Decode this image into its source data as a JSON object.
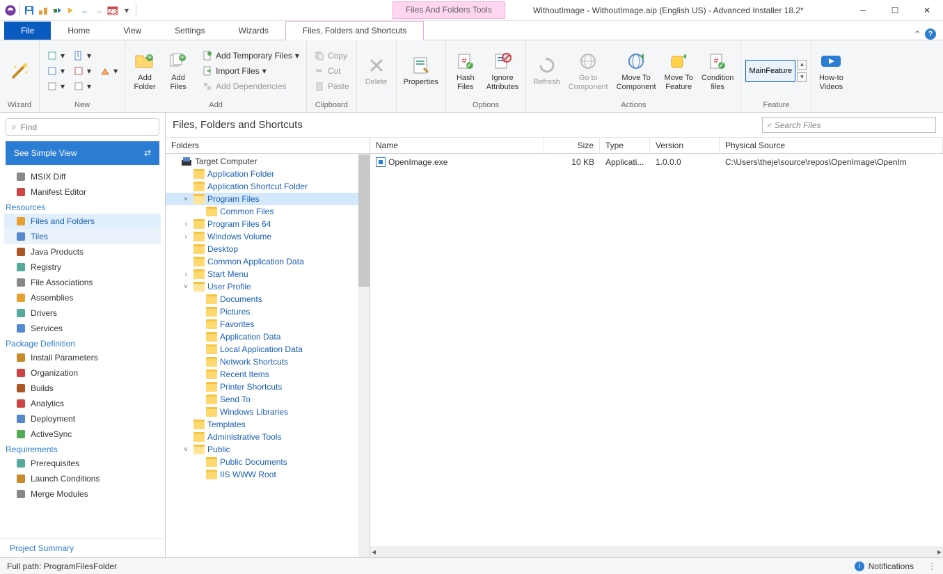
{
  "titlebar": {
    "context_label": "Files And Folders Tools",
    "title": "WithoutImage - WithoutImage.aip (English US) - Advanced Installer 18.2*"
  },
  "tabs": {
    "file": "File",
    "home": "Home",
    "view": "View",
    "settings": "Settings",
    "wizards": "Wizards",
    "context": "Files, Folders and Shortcuts"
  },
  "ribbon": {
    "wizard": {
      "label": "Wizard"
    },
    "new": {
      "label": "New"
    },
    "add": {
      "label": "Add",
      "add_folder": "Add\nFolder",
      "add_files": "Add\nFiles",
      "add_temp": "Add Temporary Files",
      "import_files": "Import Files",
      "add_deps": "Add Dependencies"
    },
    "clipboard": {
      "label": "Clipboard",
      "copy": "Copy",
      "cut": "Cut",
      "paste": "Paste"
    },
    "delete": "Delete",
    "properties": "Properties",
    "options": {
      "label": "Options",
      "hash": "Hash\nFiles",
      "ignore": "Ignore\nAttributes"
    },
    "actions": {
      "label": "Actions",
      "refresh": "Refresh",
      "goto": "Go to\nComponent",
      "move_comp": "Move To\nComponent",
      "move_feat": "Move To\nFeature",
      "cond": "Condition\nfiles"
    },
    "feature": {
      "label": "Feature",
      "value": "MainFeature"
    },
    "howto": "How-to\nVideos"
  },
  "left": {
    "find_placeholder": "Find",
    "simple_view": "See Simple View",
    "items_top": [
      {
        "label": "MSIX Diff"
      },
      {
        "label": "Manifest Editor"
      }
    ],
    "section_resources": "Resources",
    "resources": [
      {
        "label": "Files and Folders",
        "primary": true
      },
      {
        "label": "Tiles",
        "secondary": true
      },
      {
        "label": "Java Products"
      },
      {
        "label": "Registry"
      },
      {
        "label": "File Associations"
      },
      {
        "label": "Assemblies"
      },
      {
        "label": "Drivers"
      },
      {
        "label": "Services"
      }
    ],
    "section_pkg": "Package Definition",
    "pkg": [
      {
        "label": "Install Parameters"
      },
      {
        "label": "Organization"
      },
      {
        "label": "Builds"
      },
      {
        "label": "Analytics"
      },
      {
        "label": "Deployment"
      },
      {
        "label": "ActiveSync"
      }
    ],
    "section_req": "Requirements",
    "req": [
      {
        "label": "Prerequisites"
      },
      {
        "label": "Launch Conditions"
      },
      {
        "label": "Merge Modules"
      }
    ],
    "footer": "Project Summary"
  },
  "center": {
    "title": "Files, Folders and Shortcuts",
    "search_placeholder": "Search Files",
    "folders_label": "Folders",
    "tree": [
      {
        "label": "Target Computer",
        "indent": 0,
        "root": true,
        "exp": ""
      },
      {
        "label": "Application Folder",
        "indent": 1,
        "exp": ""
      },
      {
        "label": "Application Shortcut Folder",
        "indent": 1,
        "exp": ""
      },
      {
        "label": "Program Files",
        "indent": 1,
        "exp": "˅",
        "sel": true,
        "open": true
      },
      {
        "label": "Common Files",
        "indent": 2,
        "exp": ""
      },
      {
        "label": "Program Files 64",
        "indent": 1,
        "exp": "›"
      },
      {
        "label": "Windows Volume",
        "indent": 1,
        "exp": "›"
      },
      {
        "label": "Desktop",
        "indent": 1,
        "exp": ""
      },
      {
        "label": "Common Application Data",
        "indent": 1,
        "exp": ""
      },
      {
        "label": "Start Menu",
        "indent": 1,
        "exp": "›"
      },
      {
        "label": "User Profile",
        "indent": 1,
        "exp": "˅",
        "open": true
      },
      {
        "label": "Documents",
        "indent": 2,
        "exp": ""
      },
      {
        "label": "Pictures",
        "indent": 2,
        "exp": ""
      },
      {
        "label": "Favorites",
        "indent": 2,
        "exp": ""
      },
      {
        "label": "Application Data",
        "indent": 2,
        "exp": ""
      },
      {
        "label": "Local Application Data",
        "indent": 2,
        "exp": ""
      },
      {
        "label": "Network Shortcuts",
        "indent": 2,
        "exp": ""
      },
      {
        "label": "Recent Items",
        "indent": 2,
        "exp": ""
      },
      {
        "label": "Printer Shortcuts",
        "indent": 2,
        "exp": ""
      },
      {
        "label": "Send To",
        "indent": 2,
        "exp": ""
      },
      {
        "label": "Windows Libraries",
        "indent": 2,
        "exp": ""
      },
      {
        "label": "Templates",
        "indent": 1,
        "exp": ""
      },
      {
        "label": "Administrative Tools",
        "indent": 1,
        "exp": ""
      },
      {
        "label": "Public",
        "indent": 1,
        "exp": "˅",
        "open": true
      },
      {
        "label": "Public Documents",
        "indent": 2,
        "exp": ""
      },
      {
        "label": "IIS WWW Root",
        "indent": 2,
        "exp": ""
      }
    ],
    "columns": {
      "name": "Name",
      "size": "Size",
      "type": "Type",
      "version": "Version",
      "source": "Physical Source"
    },
    "rows": [
      {
        "name": "OpenImage.exe",
        "size": "10 KB",
        "type": "Applicati...",
        "version": "1.0.0.0",
        "source": "C:\\Users\\theje\\source\\repos\\OpenImage\\OpenIm"
      }
    ]
  },
  "status": {
    "path": "Full path: ProgramFilesFolder",
    "notifications": "Notifications"
  }
}
